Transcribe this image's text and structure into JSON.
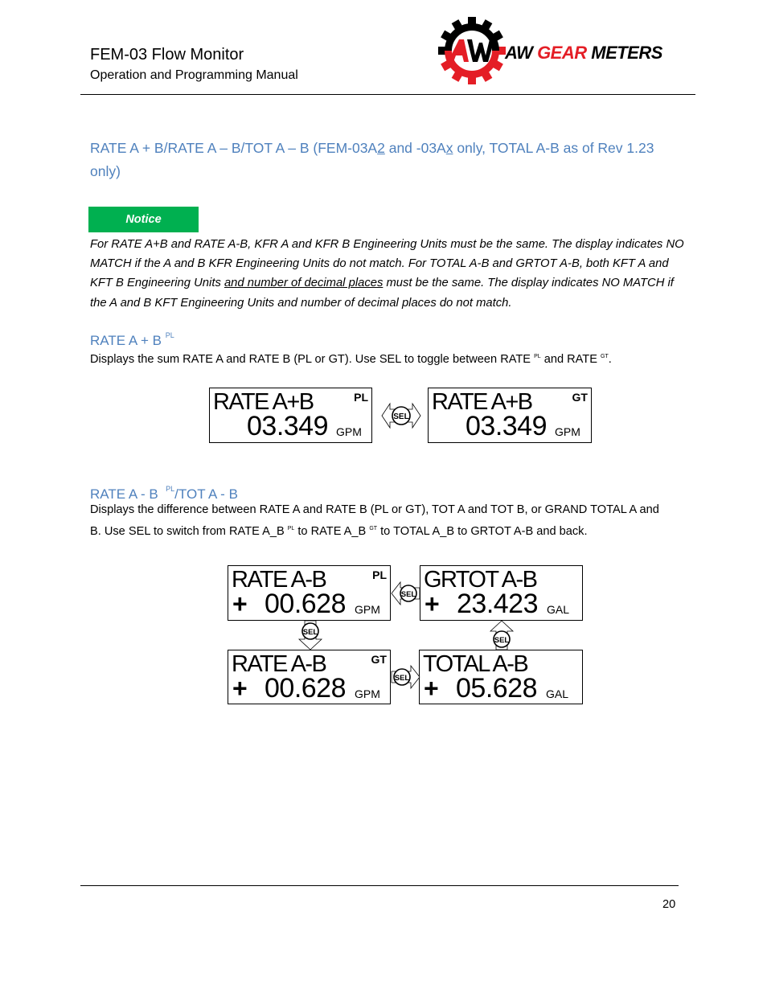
{
  "header": {
    "title": "FEM-03 Flow Monitor",
    "subtitle": "Operation and Programming Manual",
    "logo": {
      "icon": "gear-aw-logo-icon",
      "text_black_1": "AW ",
      "text_red": "GEAR",
      "text_black_2": " METERS",
      "colors": {
        "red": "#e41e26",
        "black": "#000000"
      }
    }
  },
  "section": {
    "heading_part1": "RATE A + B/RATE A – B/TOT A – B  (FEM-03A",
    "heading_u1": "2",
    "heading_part2": " and -03A",
    "heading_u2": "x",
    "heading_part3": " only, TOTAL A-B as of Rev 1.23 only)",
    "heading_color": "#4f81bd"
  },
  "notice": {
    "label": "Notice",
    "color": "#00b050",
    "text_before": "For RATE A+B and RATE A-B, KFR A and KFR B Engineering Units must be the same. The display indicates NO MATCH if the A and B KFR Engineering Units do not match. For TOTAL A-B and GRTOT A-B, both KFT A and KFT B Engineering Units ",
    "text_underlined": "and number of decimal places",
    "text_after": " must be the same. The display indicates NO MATCH if the A and B KFT Engineering Units and number of decimal places do not match."
  },
  "rate_sum": {
    "heading": "RATE A + B ",
    "heading_sup": "PL",
    "desc_1": "Displays the sum RATE A and RATE B (PL or GT). Use SEL to toggle between RATE ",
    "desc_sup1": "PL",
    "desc_2": " and RATE ",
    "desc_sup2": "GT",
    "desc_3": ".",
    "displays": [
      {
        "line1": "RATE A+B",
        "tag": "PL",
        "value": "03.349",
        "unit": "GPM"
      },
      {
        "line1": "RATE A+B",
        "tag": "GT",
        "value": "03.349",
        "unit": "GPM"
      }
    ],
    "sel_label": "SEL"
  },
  "rate_diff": {
    "heading_1": "RATE A - B  ",
    "heading_sup": "PL",
    "heading_2": "/TOT A - B",
    "desc_1": "Displays the difference between RATE A and RATE B (PL or GT), TOT A and TOT B, or GRAND TOTAL A and B. Use SEL to switch from RATE A_B ",
    "desc_sup1": "PL",
    "desc_2": " to RATE A_B ",
    "desc_sup2": "GT",
    "desc_3": " to TOTAL A_B to GRTOT A-B and back.",
    "displays": [
      {
        "line1": "RATE A-B",
        "tag": "PL",
        "sign": "+",
        "value": "00.628",
        "unit": "GPM"
      },
      {
        "line1": "GRTOT A-B",
        "tag": "",
        "sign": "+",
        "value": "23.423",
        "unit": "GAL"
      },
      {
        "line1": "RATE A-B",
        "tag": "GT",
        "sign": "+",
        "value": "00.628",
        "unit": "GPM"
      },
      {
        "line1": "TOTAL A-B",
        "tag": "",
        "sign": "+",
        "value": "05.628",
        "unit": "GAL"
      }
    ],
    "sel_label": "SEL"
  },
  "footer": {
    "page_number": "20"
  }
}
